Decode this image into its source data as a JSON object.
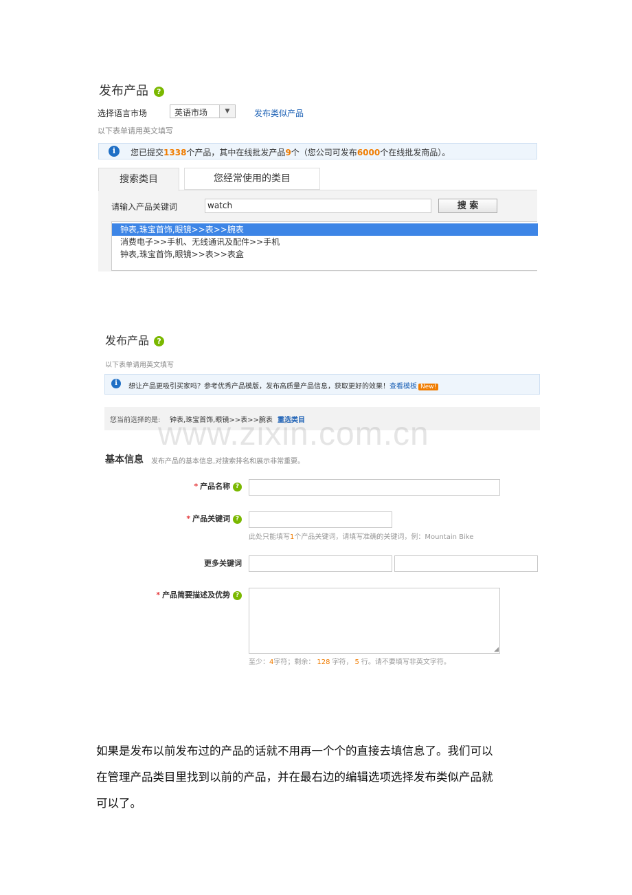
{
  "s1": {
    "title": "发布产品",
    "lang_label": "选择语言市场",
    "lang_value": "英语市场",
    "similar_link": "发布类似产品",
    "note": "以下表单请用英文填写",
    "info_prefix": "您已提交",
    "info_submitted": "1338",
    "info_mid1": "个产品，其中在线批发产品",
    "info_online": "9",
    "info_mid2": "个（您公司可发布",
    "info_max": "6000",
    "info_suffix": "个在线批发商品）。",
    "tab_search": "搜索类目",
    "tab_frequent": "您经常使用的类目",
    "keyword_label": "请输入产品关键词",
    "keyword_value": "watch",
    "search_button": "搜 索",
    "results": [
      "钟表,珠宝首饰,眼镜>>表>>腕表",
      "消费电子>>手机、无线通讯及配件>>手机",
      "钟表,珠宝首饰,眼镜>>表>>表盒"
    ]
  },
  "s2": {
    "title": "发布产品",
    "note": "以下表单请用英文填写",
    "info_text": "想让产品更吸引买家吗？参考优秀产品模版，发布高质量产品信息，获取更好的效果！",
    "info_link": "查看模板",
    "new_badge": "New!",
    "selected_label": "您当前选择的是:",
    "selected_value": "钟表,珠宝首饰,眼镜>>表>>腕表",
    "reselect_link": "重选类目",
    "section_title": "基本信息",
    "section_desc": "发布产品的基本信息,对搜索排名和展示非常重要。",
    "name_label": "产品名称",
    "keyword_label": "产品关键词",
    "keyword_hint_pre": "此处只能填写",
    "keyword_hint_num": "1",
    "keyword_hint_post": "个产品关键词，请填写准确的关键词，例：Mountain Bike",
    "more_keywords_label": "更多关键词",
    "desc_label": "产品简要描述及优势",
    "counter_pre": "至少：",
    "counter_min": "4",
    "counter_mid1": "字符；剩余：",
    "counter_remain": "128",
    "counter_mid2": "字符，",
    "counter_lines": "5",
    "counter_post": "行。请不要填写非英文字符。"
  },
  "watermark": "www.zixin.com.cn",
  "paragraph": {
    "line1": "如果是发布以前发布过的产品的话就不用再一个个的直接去填信息了。我们可以",
    "line2a": "在管理产品类目里找到以前的产品，并在最右边的编辑选项选择",
    "line2b": "发布类似产品",
    "line2c": "就",
    "line3": "可以了。"
  },
  "colors": {
    "accent_green": "#7ab800",
    "link_blue": "#1a5fb4",
    "highlight_orange": "#f07c00",
    "selected_row": "#3d85e6"
  }
}
